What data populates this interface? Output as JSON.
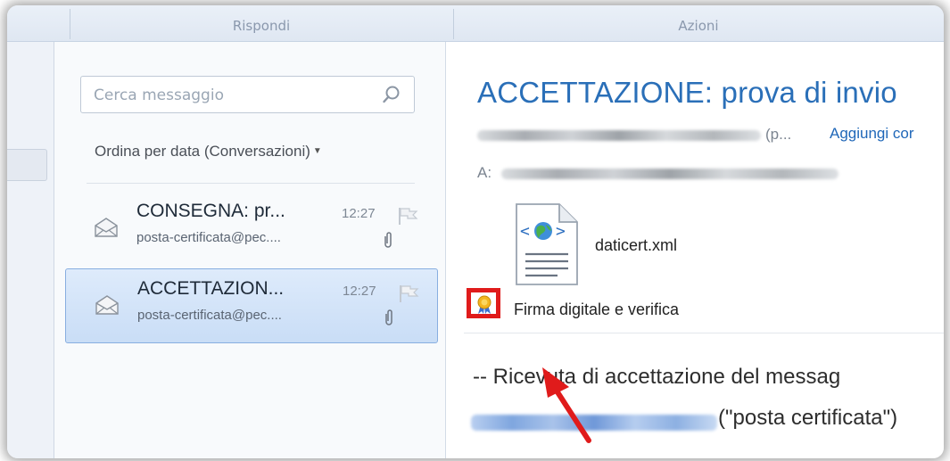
{
  "ribbon": {
    "groups": [
      "Rispondi",
      "Azioni"
    ]
  },
  "search": {
    "placeholder": "Cerca messaggio",
    "icon": "search-icon"
  },
  "list": {
    "sort_label": "Ordina per data (Conversazioni)",
    "items": [
      {
        "subject": "CONSEGNA: pr...",
        "time": "12:27",
        "sender": "posta-certificata@pec....",
        "selected": false,
        "has_attachment": true
      },
      {
        "subject": "ACCETTAZION...",
        "time": "12:27",
        "sender": "posta-certificata@pec....",
        "selected": true,
        "has_attachment": true
      }
    ]
  },
  "reading": {
    "subject": "ACCETTAZIONE: prova di invio",
    "from_trail": "(p...",
    "add_contact": "Aggiungi cor",
    "to_label": "A:",
    "attachment_name": "daticert.xml",
    "signature_label": "Firma digitale e verifica",
    "body_line1": "-- Ricevuta di accettazione del messag",
    "body_line2": "(\"posta certificata\")"
  },
  "colors": {
    "accent": "#2a6fb8",
    "highlight": "#e01b1b",
    "selection": "#c9ddf6"
  }
}
